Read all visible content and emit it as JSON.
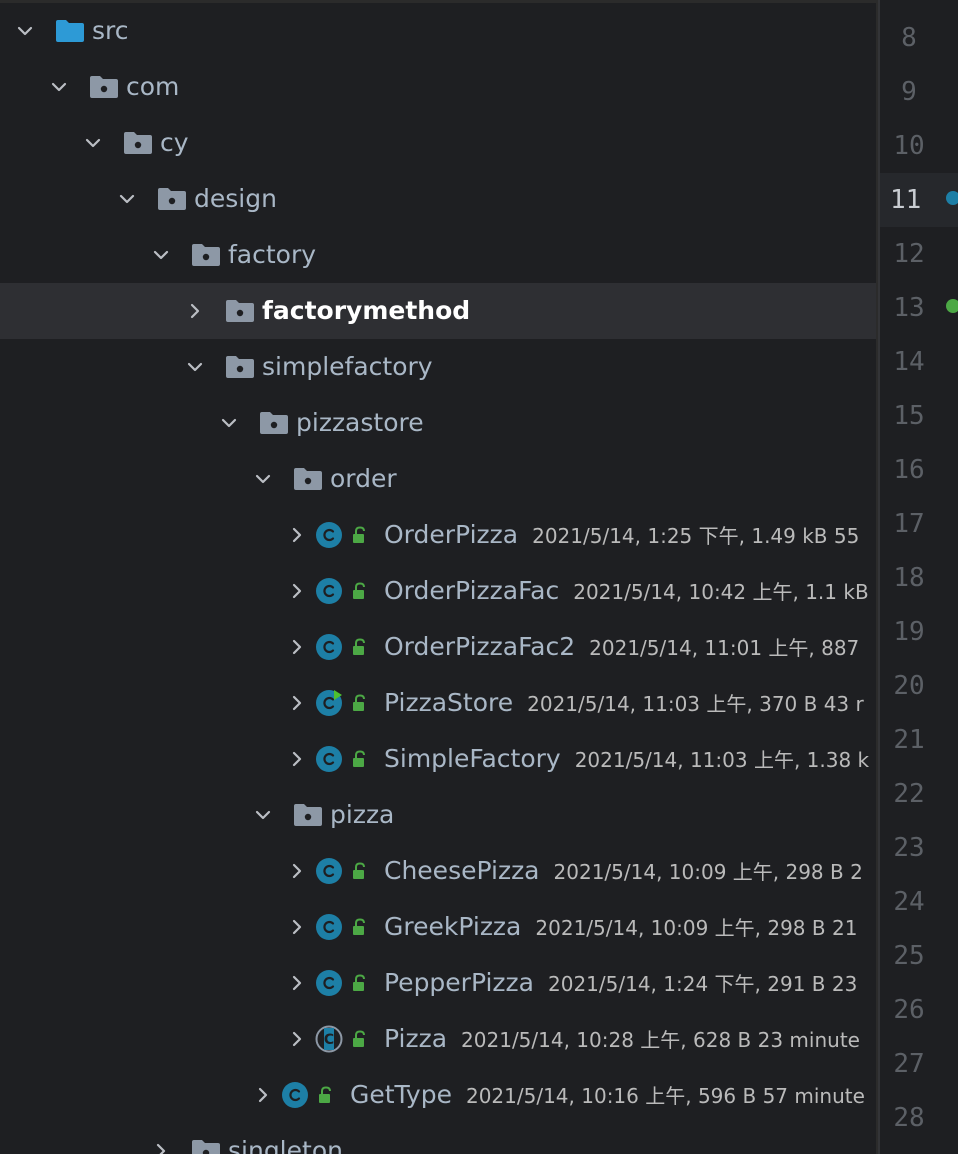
{
  "colors": {
    "folder": "#8d98a6",
    "src_folder": "#2d9ad6",
    "class_icon": "#1d7fa6",
    "lock": "#4ca845",
    "selected_row": "#2e2f33"
  },
  "tree": [
    {
      "label": "src",
      "expanded": true,
      "kind": "source-folder"
    },
    {
      "label": "com",
      "expanded": true,
      "kind": "package"
    },
    {
      "label": "cy",
      "expanded": true,
      "kind": "package"
    },
    {
      "label": "design",
      "expanded": true,
      "kind": "package"
    },
    {
      "label": "factory",
      "expanded": true,
      "kind": "package"
    },
    {
      "label": "factorymethod",
      "expanded": false,
      "kind": "package",
      "selected": true
    },
    {
      "label": "simplefactory",
      "expanded": true,
      "kind": "package"
    },
    {
      "label": "pizzastore",
      "expanded": true,
      "kind": "package"
    },
    {
      "label": "order",
      "expanded": true,
      "kind": "package"
    },
    {
      "label": "OrderPizza",
      "meta": "2021/5/14, 1:25 下午, 1.49 kB 55",
      "kind": "class"
    },
    {
      "label": "OrderPizzaFac",
      "meta": "2021/5/14, 10:42 上午, 1.1 kB",
      "kind": "class"
    },
    {
      "label": "OrderPizzaFac2",
      "meta": "2021/5/14, 11:01 上午, 887",
      "kind": "class"
    },
    {
      "label": "PizzaStore",
      "meta": "2021/5/14, 11:03 上午, 370 B 43 r",
      "kind": "class-runnable"
    },
    {
      "label": "SimpleFactory",
      "meta": "2021/5/14, 11:03 上午, 1.38 k",
      "kind": "class"
    },
    {
      "label": "pizza",
      "expanded": true,
      "kind": "package"
    },
    {
      "label": "CheesePizza",
      "meta": "2021/5/14, 10:09 上午, 298 B 2",
      "kind": "class"
    },
    {
      "label": "GreekPizza",
      "meta": "2021/5/14, 10:09 上午, 298 B 21",
      "kind": "class"
    },
    {
      "label": "PepperPizza",
      "meta": "2021/5/14, 1:24 下午, 291 B 23",
      "kind": "class"
    },
    {
      "label": "Pizza",
      "meta": "2021/5/14, 10:28 上午, 628 B 23 minute",
      "kind": "abstract-class"
    },
    {
      "label": "GetType",
      "meta": "2021/5/14, 10:16 上午, 596 B 57 minute",
      "kind": "class"
    },
    {
      "label": "singleton",
      "expanded": false,
      "kind": "package"
    }
  ],
  "gutter": {
    "line_numbers": [
      "8",
      "9",
      "10",
      "11",
      "12",
      "13",
      "14",
      "15",
      "16",
      "17",
      "18",
      "19",
      "20",
      "21",
      "22",
      "23",
      "24",
      "25",
      "26",
      "27",
      "28"
    ],
    "current_line": "11"
  }
}
